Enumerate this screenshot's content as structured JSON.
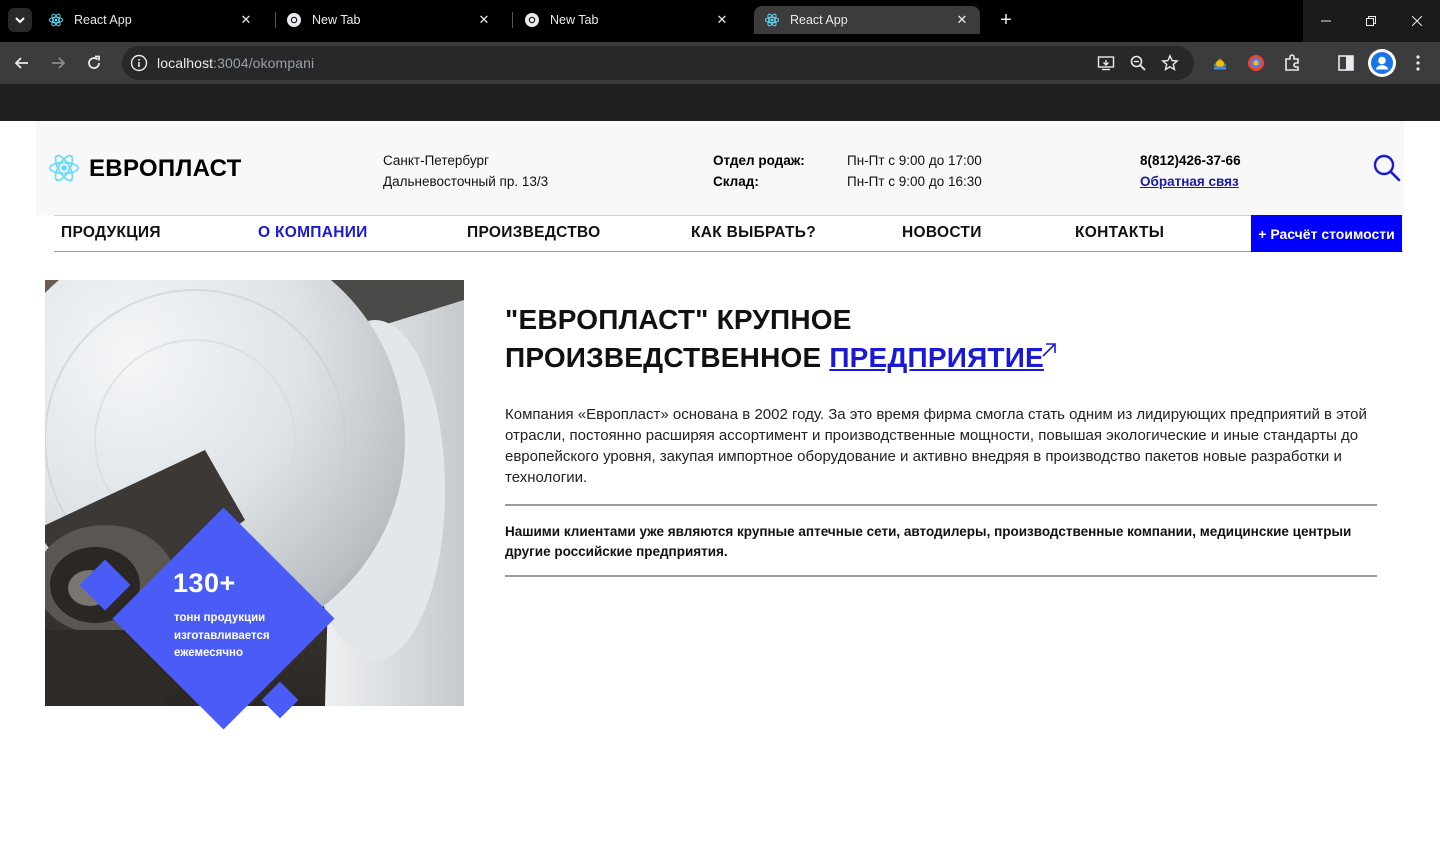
{
  "browser": {
    "tabs": [
      {
        "title": "React App",
        "icon": "react-icon",
        "active": false
      },
      {
        "title": "New Tab",
        "icon": "chrome-icon",
        "active": false
      },
      {
        "title": "New Tab",
        "icon": "chrome-icon",
        "active": false
      },
      {
        "title": "React App",
        "icon": "react-icon",
        "active": true
      }
    ],
    "url_host": "localhost",
    "url_rest": ":3004/okompani"
  },
  "header": {
    "logo_text": "ЕВРОПЛАСТ",
    "city": "Санкт-Петербург",
    "street": "Дальневосточный пр. 13/3",
    "sales_label": "Отдел родаж:",
    "sales_hours": "Пн-Пт с 9:00 до 17:00",
    "warehouse_label": "Склад:",
    "warehouse_hours": "Пн-Пт с 9:00 до 16:30",
    "phone": "8(812)426-37-66",
    "feedback": "Обратная связ"
  },
  "nav": {
    "items": [
      "ПРОДУКЦИЯ",
      "О КОМПАНИИ",
      "ПРОИЗВЕДСТВО",
      "КАК ВЫБРАТЬ?",
      "НОВОСТИ",
      "КОНТАКТЫ"
    ],
    "active": "О КОМПАНИИ",
    "calc_button": "+ Расчёт стоимости"
  },
  "hero": {
    "stat_number": "130+",
    "stat_line1": "тонн продукции",
    "stat_line2": "изготавливается",
    "stat_line3": "ежемесячно"
  },
  "about": {
    "heading_line1": "\"ЕВРОПЛАСТ\" КРУПНОЕ",
    "heading_line2": "ПРОИЗВЕДСТВЕННОЕ ",
    "heading_link": "ПРЕДПРИЯТИЕ ",
    "paragraph": "Компания «Европласт» основана в 2002 году. За это время фирма смогла стать одним из лидирующих предприятий в этой отрасли, постоянно расширяя ассортимент и производственные мощности, повышая экологические и иные стандарты до европейского уровня, закупая импортное оборудование и активно внедряя в производство пакетов новые разработки и технологии.",
    "clients": "Нашими клиентами уже являются крупные аптечные сети, автодилеры, производственные компании, медицинские центрыи другие российские предприятия."
  },
  "colors": {
    "accent": "#0000ff",
    "badge": "#4a5cf6",
    "link": "#1a1ad6"
  }
}
